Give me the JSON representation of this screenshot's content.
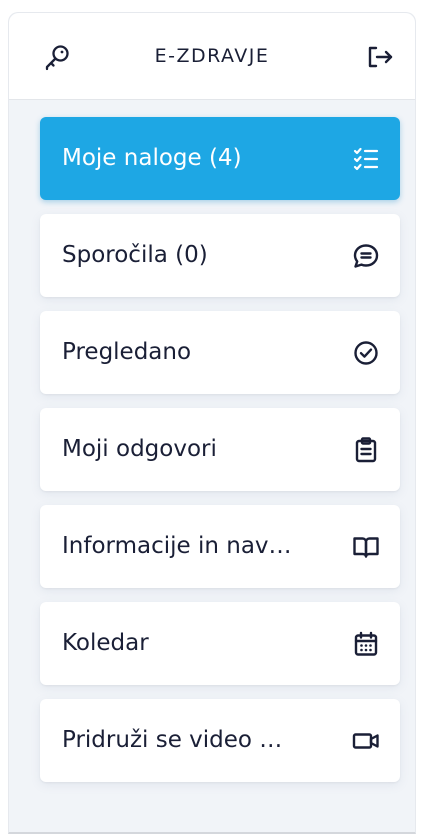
{
  "header": {
    "title": "E-ZDRAVJE",
    "left_icon": "key-icon",
    "right_icon": "logout-icon"
  },
  "colors": {
    "accent": "#1ea7e4",
    "text": "#1a1f36",
    "background": "#f1f4f8"
  },
  "menu": {
    "items": [
      {
        "label": "Moje naloge (4)",
        "icon": "tasks-list-icon",
        "active": true
      },
      {
        "label": "Sporočila (0)",
        "icon": "chat-icon",
        "active": false
      },
      {
        "label": "Pregledano",
        "icon": "check-circle-icon",
        "active": false
      },
      {
        "label": "Moji odgovori",
        "icon": "clipboard-icon",
        "active": false
      },
      {
        "label": "Informacije in nav…",
        "icon": "book-icon",
        "active": false
      },
      {
        "label": "Koledar",
        "icon": "calendar-icon",
        "active": false
      },
      {
        "label": "Pridruži se video …",
        "icon": "video-camera-icon",
        "active": false
      }
    ]
  }
}
